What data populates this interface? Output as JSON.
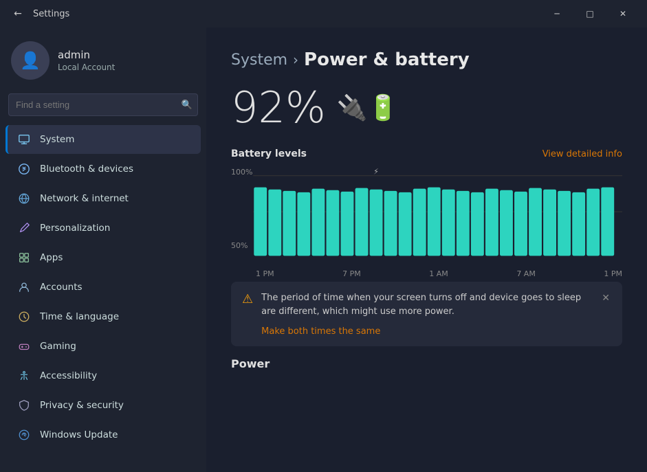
{
  "titlebar": {
    "title": "Settings",
    "back_icon": "←",
    "minimize_icon": "─",
    "maximize_icon": "□",
    "close_icon": "✕"
  },
  "user": {
    "name": "admin",
    "type": "Local Account",
    "avatar_icon": "👤"
  },
  "search": {
    "placeholder": "Find a setting",
    "icon": "🔍"
  },
  "nav": {
    "items": [
      {
        "id": "system",
        "label": "System",
        "icon": "💻",
        "active": true
      },
      {
        "id": "bluetooth",
        "label": "Bluetooth & devices",
        "icon": "🔵"
      },
      {
        "id": "network",
        "label": "Network & internet",
        "icon": "🌐"
      },
      {
        "id": "personalization",
        "label": "Personalization",
        "icon": "🎨"
      },
      {
        "id": "apps",
        "label": "Apps",
        "icon": "📦"
      },
      {
        "id": "accounts",
        "label": "Accounts",
        "icon": "👤"
      },
      {
        "id": "time",
        "label": "Time & language",
        "icon": "🕐"
      },
      {
        "id": "gaming",
        "label": "Gaming",
        "icon": "🎮"
      },
      {
        "id": "accessibility",
        "label": "Accessibility",
        "icon": "♿"
      },
      {
        "id": "privacy",
        "label": "Privacy & security",
        "icon": "🔒"
      },
      {
        "id": "update",
        "label": "Windows Update",
        "icon": "🔄"
      }
    ]
  },
  "breadcrumb": {
    "parent": "System",
    "separator": "›",
    "current": "Power & battery"
  },
  "battery": {
    "percentage": "92%",
    "icon": "🔌"
  },
  "chart": {
    "title": "Battery levels",
    "link": "View detailed info",
    "y_labels": [
      "100%",
      "50%"
    ],
    "x_labels": [
      "1 PM",
      "7 PM",
      "1 AM",
      "7 AM",
      "1 PM"
    ],
    "accent_color": "#2dd4bf",
    "bars": [
      95,
      92,
      90,
      88,
      93,
      91,
      89,
      94,
      92,
      90,
      88,
      93,
      95,
      92,
      90,
      88,
      93,
      91,
      89,
      94,
      92,
      90,
      88,
      93,
      95
    ]
  },
  "warning": {
    "icon": "⚠",
    "text": "The period of time when your screen turns off and device goes to sleep are different, which might use more power.",
    "link": "Make both times the same",
    "close_icon": "✕"
  },
  "power_section": {
    "title": "Power"
  }
}
